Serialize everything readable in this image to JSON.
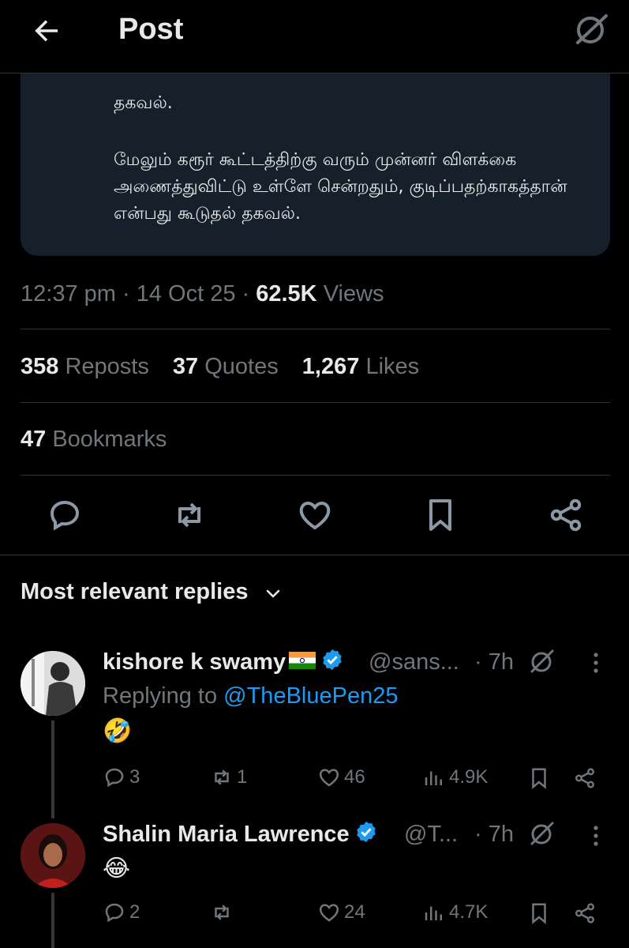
{
  "header": {
    "title": "Post"
  },
  "post": {
    "quote_text_1": "தகவல்.",
    "quote_text_2": "மேலும் கரூர் கூட்டத்திற்கு வரும் முன்னர் விளக்கை அணைத்துவிட்டு உள்ளே சென்றதும், குடிப்பதற்காகத்தான் என்பது கூடுதல் தகவல்.",
    "time": "12:37 pm",
    "date": "14 Oct 25",
    "views_count": "62.5K",
    "views_label": "Views",
    "reposts_count": "358",
    "reposts_label": "Reposts",
    "quotes_count": "37",
    "quotes_label": "Quotes",
    "likes_count": "1,267",
    "likes_label": "Likes",
    "bookmarks_count": "47",
    "bookmarks_label": "Bookmarks"
  },
  "replies_header": "Most relevant replies",
  "replies": [
    {
      "name": "kishore k swamy",
      "handle": "@sans...",
      "time": "· 7h",
      "replying_prefix": "Replying to",
      "replying_to": "@TheBluePen25",
      "content": "🤣",
      "replies": "3",
      "reposts": "1",
      "likes": "46",
      "views": "4.9K"
    },
    {
      "name": "Shalin Maria Lawrence",
      "handle": "@T...",
      "time": "· 7h",
      "content": "😂",
      "replies": "2",
      "reposts": "",
      "likes": "24",
      "views": "4.7K"
    }
  ],
  "colors": {
    "accent": "#1d9bf0",
    "muted": "#71767b",
    "text": "#e7e9ea",
    "card": "#16202b"
  }
}
